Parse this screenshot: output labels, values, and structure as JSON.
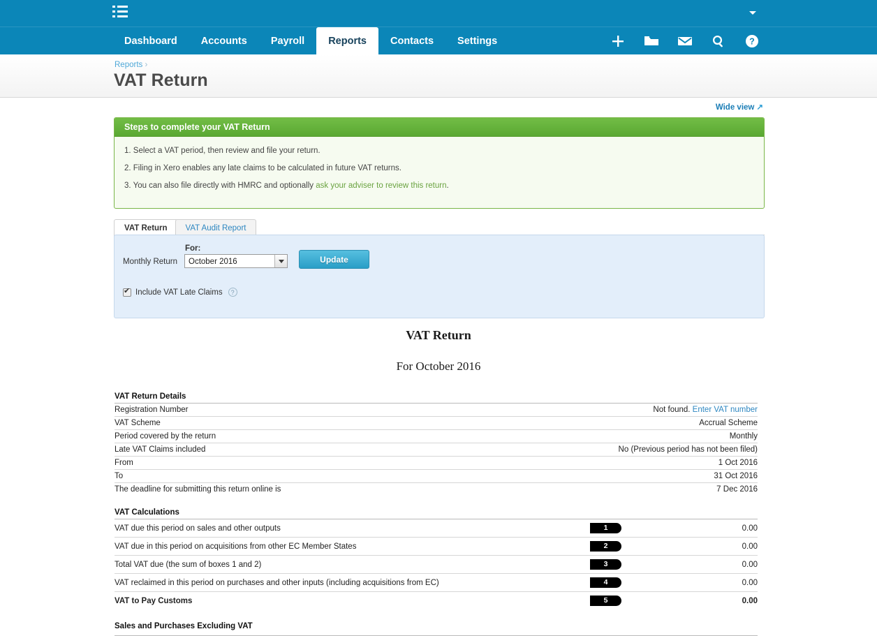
{
  "topbar": {
    "menu_icon": "list-icon",
    "account_caret": "chevron-down-icon"
  },
  "nav": {
    "tabs": [
      {
        "label": "Dashboard",
        "active": false
      },
      {
        "label": "Accounts",
        "active": false
      },
      {
        "label": "Payroll",
        "active": false
      },
      {
        "label": "Reports",
        "active": true
      },
      {
        "label": "Contacts",
        "active": false
      },
      {
        "label": "Settings",
        "active": false
      }
    ],
    "icons": [
      "plus-icon",
      "folder-icon",
      "envelope-icon",
      "search-icon",
      "help-icon"
    ]
  },
  "header": {
    "breadcrumb_parent": "Reports",
    "breadcrumb_separator": "›",
    "title": "VAT Return"
  },
  "toolbar": {
    "wide_view_label": "Wide view",
    "wide_view_icon": "external-link-arrow-icon"
  },
  "steps_panel": {
    "heading": "Steps to complete your VAT Return",
    "step1": "1. Select a VAT period, then review and file your return.",
    "step2": "2. Filing in Xero enables any late claims to be calculated in future VAT returns.",
    "step3_prefix": "3. You can also file directly with HMRC and optionally ",
    "step3_link": "ask your adviser to review this return",
    "step3_suffix": "."
  },
  "tabs": [
    {
      "label": "VAT Return",
      "active": true
    },
    {
      "label": "VAT Audit Report",
      "active": false
    }
  ],
  "filters": {
    "return_type_label": "Monthly Return",
    "for_label": "For:",
    "period_value": "October 2016",
    "period_options": [
      "October 2016"
    ],
    "update_label": "Update",
    "late_claims_label": "Include VAT Late Claims",
    "late_claims_checked": true,
    "help_icon": "question-mark-icon"
  },
  "report": {
    "title": "VAT Return",
    "subtitle": "For October 2016",
    "details_heading": "VAT Return Details",
    "details_rows": [
      {
        "label": "Registration Number",
        "value": "Not found. ",
        "link": "Enter VAT number"
      },
      {
        "label": "VAT Scheme",
        "value": "Accrual Scheme",
        "link": ""
      },
      {
        "label": "Period covered by the return",
        "value": "Monthly",
        "link": ""
      },
      {
        "label": "Late VAT Claims included",
        "value": "No (Previous period has not been filed)",
        "link": ""
      },
      {
        "label": "From",
        "value": "1 Oct 2016",
        "link": ""
      },
      {
        "label": "To",
        "value": "31 Oct 2016",
        "link": ""
      },
      {
        "label": "The deadline for submitting this return online is",
        "value": "7 Dec 2016",
        "link": ""
      }
    ],
    "calculations_heading": "VAT Calculations",
    "calculation_rows": [
      {
        "label": "VAT due this period on sales and other outputs",
        "box": "1",
        "value": "0.00",
        "bold": false
      },
      {
        "label": "VAT due in this period on acquisitions from other EC Member States",
        "box": "2",
        "value": "0.00",
        "bold": false
      },
      {
        "label": "Total VAT due (the sum of boxes 1 and 2)",
        "box": "3",
        "value": "0.00",
        "bold": false
      },
      {
        "label": "VAT reclaimed in this period on purchases and other inputs (including acquisitions from EC)",
        "box": "4",
        "value": "0.00",
        "bold": false
      },
      {
        "label": "VAT to Pay Customs",
        "box": "5",
        "value": "0.00",
        "bold": true
      }
    ],
    "sales_heading": "Sales and Purchases Excluding VAT"
  }
}
